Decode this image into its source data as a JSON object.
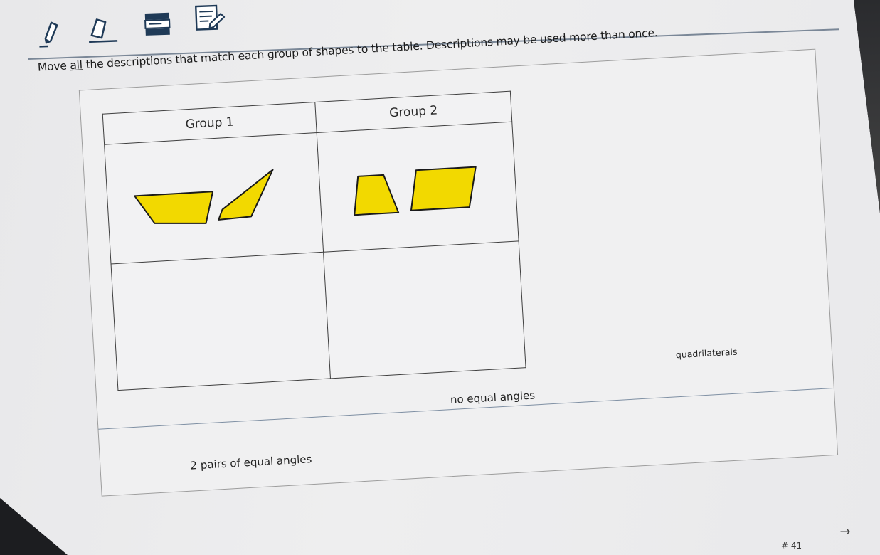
{
  "toolbar": {
    "tools": [
      {
        "name": "pencil-tool",
        "icon": "pencil-icon"
      },
      {
        "name": "eraser-tool",
        "icon": "eraser-icon"
      },
      {
        "name": "line-reader-tool",
        "icon": "line-reader-icon"
      },
      {
        "name": "notepad-tool",
        "icon": "notepad-icon"
      }
    ]
  },
  "question": {
    "prompt_before": "Move ",
    "prompt_emphasis": "all",
    "prompt_after": " the descriptions that match each group of shapes to the table. Descriptions may be used more than once."
  },
  "table": {
    "columns": [
      "Group 1",
      "Group 2"
    ],
    "shape_color": "#f2d900",
    "shape_outline": "#1a1a1a"
  },
  "descriptions": [
    {
      "id": "two-pairs",
      "label": "2 pairs of equal angles"
    },
    {
      "id": "no-equal",
      "label": "no equal angles"
    },
    {
      "id": "quadrilaterals",
      "label": "quadrilaterals"
    }
  ],
  "footer": {
    "next_icon": "arrow-right-icon",
    "next_glyph": "→",
    "question_number": "# 41"
  }
}
